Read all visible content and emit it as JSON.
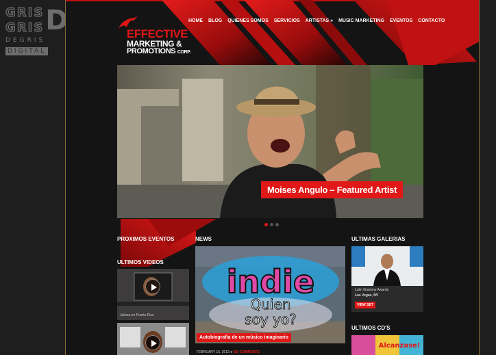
{
  "sidebar_brand": {
    "gris_top": "GRIS",
    "gris_bottom": "GRIS",
    "letter": "D",
    "degris": "DEGRIS",
    "digital": "DIGITAL"
  },
  "logo": {
    "line1": "EFFECTIVE",
    "line2": "MARKETING &",
    "line3_main": "PROMOTIONS",
    "line3_small": "CORP."
  },
  "nav": {
    "items": [
      "HOME",
      "BLOG",
      "QUIENES SOMOS",
      "SERVICIOS",
      "ARTISTAS »",
      "MUSIC MARKETING",
      "EVENTOS",
      "CONTACTO"
    ]
  },
  "slider": {
    "caption": "Moises Angulo – Featured Artist",
    "total_slides": 3,
    "active_slide": 1
  },
  "sections": {
    "proximos_eventos": "PROXIMOS EVENTOS",
    "news": "NEWS",
    "ultimas_galerias": "ULTIMAS GALERIAS",
    "ultimos_videos": "ULTIMOS VIDEOS",
    "ultimos_cds": "ULTIMOS CD'S"
  },
  "videos": [
    {
      "caption": "Julissa en Puerto Rico"
    }
  ],
  "news": {
    "graffiti_text": "indie",
    "graffiti_sub1": "Quien",
    "graffiti_sub2": "soy yo?",
    "title": "Autobiografía de un músico imaginario",
    "date": "FEBRUARY 15, 2013",
    "comments": "NO COMMENTS"
  },
  "gallery": {
    "line1": "Latin Grammy Awards",
    "line2": "Las Vegas, NV",
    "button": "VIEW SET"
  },
  "cd": {
    "title_art": "Alcanzase!"
  }
}
